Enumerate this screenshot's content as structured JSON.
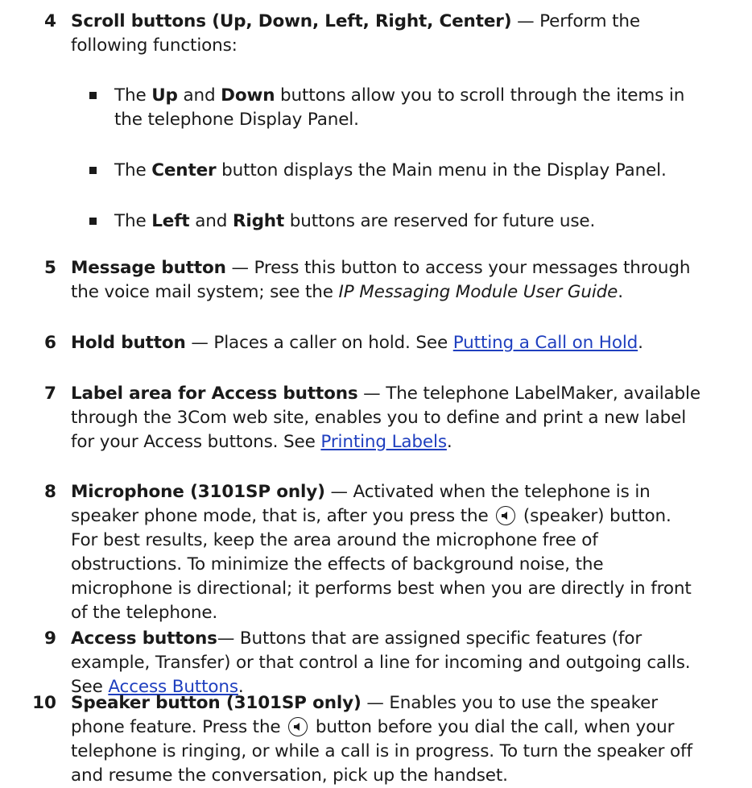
{
  "items": {
    "i4": {
      "num": "4",
      "term": "Scroll buttons (Up, Down, Left, Right, Center)",
      "lead": " — Perform the",
      "cont": "following functions:",
      "bullets": {
        "b1": {
          "pre": "The ",
          "k1": "Up",
          "mid": " and ",
          "k2": "Down",
          "post": " buttons allow you to scroll through the items in",
          "cont": "the telephone Display Panel."
        },
        "b2": {
          "pre": "The ",
          "k1": "Center",
          "post": " button displays the Main menu in the Display Panel."
        },
        "b3": {
          "pre": "The ",
          "k1": "Left",
          "mid": " and ",
          "k2": "Right",
          "post": " buttons are reserved for future use."
        }
      }
    },
    "i5": {
      "num": "5",
      "term": "Message button",
      "l1": " — Press this button to access your messages through",
      "l2pre": "the voice mail system; see the ",
      "l2ital": "IP Messaging Module User Guide",
      "l2post": "."
    },
    "i6": {
      "num": "6",
      "term": "Hold button",
      "l1": " — Places a caller on hold. See ",
      "link": "Putting a Call on Hold",
      "post": "."
    },
    "i7": {
      "num": "7",
      "term": "Label area for Access buttons",
      "l1": " — The telephone LabelMaker, available",
      "l2": "through the 3Com web site, enables you to define and print a new label",
      "l3pre": "for your Access buttons. See ",
      "link": "Printing Labels",
      "post": "."
    },
    "i8": {
      "num": "8",
      "term": "Microphone (3101SP only)",
      "l1": " — Activated when the telephone is in",
      "l2pre": "speaker phone mode, that is, after you press the ",
      "l2post": " (speaker) button.",
      "l3": "For best results, keep the area around the microphone free of",
      "l4": "obstructions. To minimize the effects of background noise, the",
      "l5": "microphone is directional; it performs best when you are directly in front",
      "l6": "of the telephone."
    },
    "i9": {
      "num": "9",
      "term": "Access buttons",
      "l1": "— Buttons that are assigned specific features (for",
      "l2": "example, Transfer) or that control a line for incoming and outgoing calls.",
      "l3pre": "See ",
      "link": "Access Buttons",
      "post": "."
    },
    "i10": {
      "num": "10",
      "term": "Speaker button (3101SP only)",
      "l1": " — Enables you to use the speaker",
      "l2pre": "phone feature. Press the ",
      "l2post": " button before you dial the call, when your",
      "l3": "telephone is ringing, or while a call is in progress. To turn the speaker off",
      "l4": "and resume the conversation, pick up the handset."
    }
  },
  "icons": {
    "speaker": "speaker-icon"
  },
  "colors": {
    "text": "#1a1a1a",
    "link": "#1f3fbf"
  }
}
